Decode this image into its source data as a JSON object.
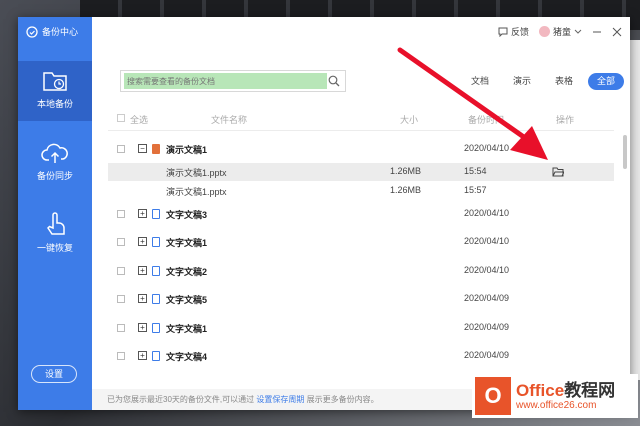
{
  "app": {
    "title": "备份中心"
  },
  "sidebar": {
    "items": [
      {
        "label": "本地备份",
        "icon": "folder-clock-icon",
        "active": true
      },
      {
        "label": "备份同步",
        "icon": "cloud-upload-icon",
        "active": false
      },
      {
        "label": "一键恢复",
        "icon": "hand-pointer-icon",
        "active": false
      }
    ],
    "settings_label": "设置"
  },
  "topbar": {
    "feedback_label": "反馈",
    "user_name": "猪童"
  },
  "search": {
    "placeholder": "搜索需要查看的备份文档"
  },
  "filters": [
    "文档",
    "演示",
    "表格",
    "全部"
  ],
  "active_filter": "全部",
  "table": {
    "select_all": "全选",
    "headers": {
      "name": "文件名称",
      "size": "大小",
      "time": "备份时间",
      "op": "操作"
    },
    "rows": [
      {
        "name": "演示文稿1",
        "date": "2020/04/10",
        "type": "ppt",
        "expanded": true,
        "children": [
          {
            "name": "演示文稿1.pptx",
            "size": "1.26MB",
            "time": "15:54"
          },
          {
            "name": "演示文稿1.pptx",
            "size": "1.26MB",
            "time": "15:57"
          }
        ]
      },
      {
        "name": "文字文稿3",
        "date": "2020/04/10",
        "type": "doc"
      },
      {
        "name": "文字文稿1",
        "date": "2020/04/10",
        "type": "doc"
      },
      {
        "name": "文字文稿2",
        "date": "2020/04/10",
        "type": "doc"
      },
      {
        "name": "文字文稿5",
        "date": "2020/04/09",
        "type": "doc"
      },
      {
        "name": "文字文稿1",
        "date": "2020/04/09",
        "type": "doc"
      },
      {
        "name": "文字文稿4",
        "date": "2020/04/09",
        "type": "doc"
      }
    ]
  },
  "footer": {
    "prefix": "已为您展示最近30天的备份文件,可以通过",
    "link": "设置保存周期",
    "suffix": "展示更多备份内容。"
  },
  "watermark": {
    "line1_a": "Office",
    "line1_b": "教程网",
    "line2": "www.office26.com"
  },
  "colors": {
    "accent": "#3d7ce8",
    "arrow": "#e8102a",
    "search_highlight": "#b8e6b8"
  }
}
